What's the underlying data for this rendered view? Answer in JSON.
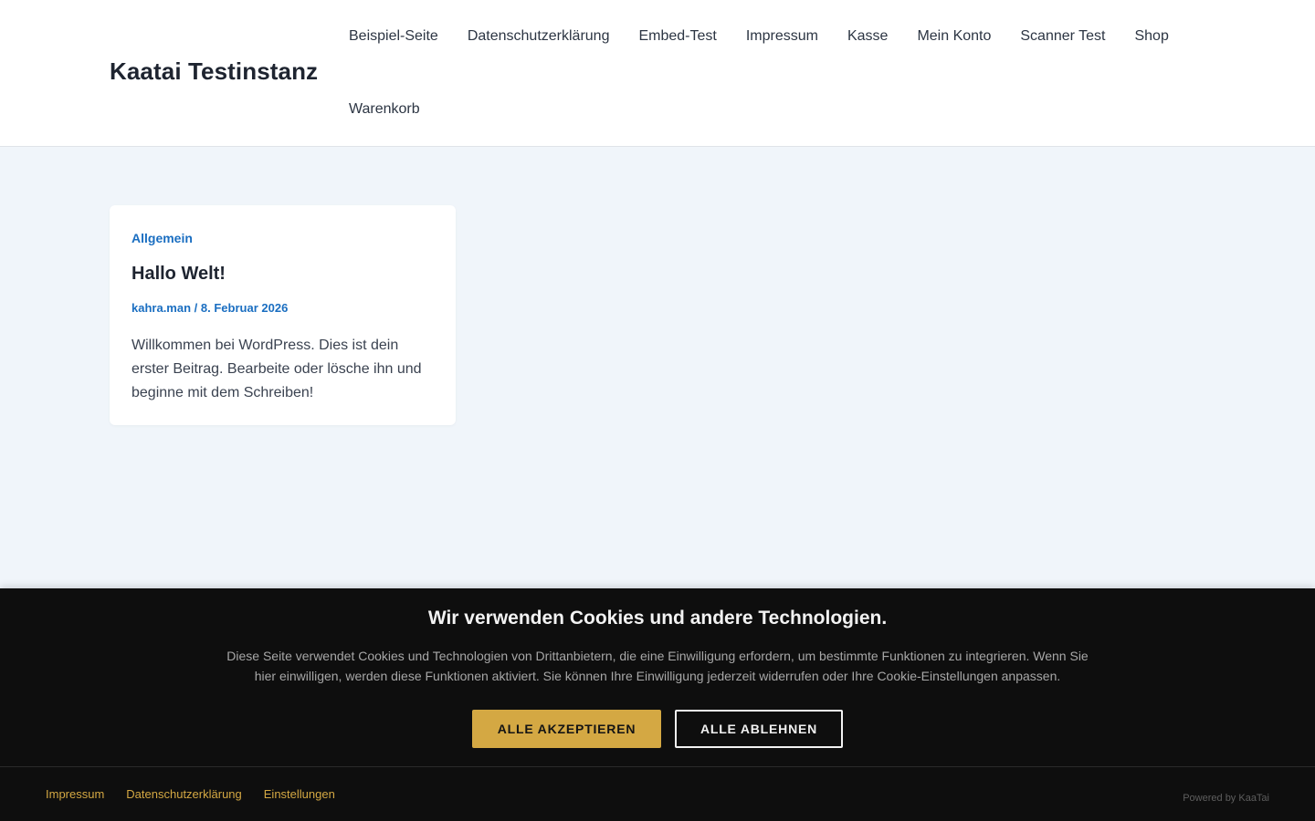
{
  "site": {
    "title": "Kaatai Testinstanz"
  },
  "nav": {
    "items": [
      {
        "label": "Beispiel-Seite"
      },
      {
        "label": "Datenschutzerklärung"
      },
      {
        "label": "Embed-Test"
      },
      {
        "label": "Impressum"
      },
      {
        "label": "Kasse"
      },
      {
        "label": "Mein Konto"
      },
      {
        "label": "Scanner Test"
      },
      {
        "label": "Shop"
      },
      {
        "label": "Warenkorb"
      }
    ]
  },
  "post": {
    "category": "Allgemein",
    "title": "Hallo Welt!",
    "author": "kahra.man",
    "separator": "/",
    "date": "8. Februar 2026",
    "excerpt": "Willkommen bei WordPress. Dies ist dein erster Beitrag. Bearbeite oder lösche ihn und beginne mit dem Schreiben!"
  },
  "cookie_banner": {
    "title": "Wir verwenden Cookies und andere Technologien.",
    "text": "Diese Seite verwendet Cookies und Technologien von Drittanbietern, die eine Einwilligung erfordern, um bestimmte Funktionen zu integrieren. Wenn Sie hier einwilligen, werden diese Funktionen aktiviert. Sie können Ihre Einwilligung jederzeit widerrufen oder Ihre Cookie-Einstellungen anpassen.",
    "accept_label": "ALLE AKZEPTIEREN",
    "reject_label": "ALLE ABLEHNEN",
    "footer_links": [
      {
        "label": "Impressum"
      },
      {
        "label": "Datenschutzerklärung"
      },
      {
        "label": "Einstellungen"
      }
    ],
    "powered_by": "Powered by KaaTai"
  },
  "colors": {
    "accent_link": "#1a6ec1",
    "page_background": "#f0f5fa",
    "banner_background": "#0e0e0e",
    "banner_accent": "#d4a843"
  }
}
